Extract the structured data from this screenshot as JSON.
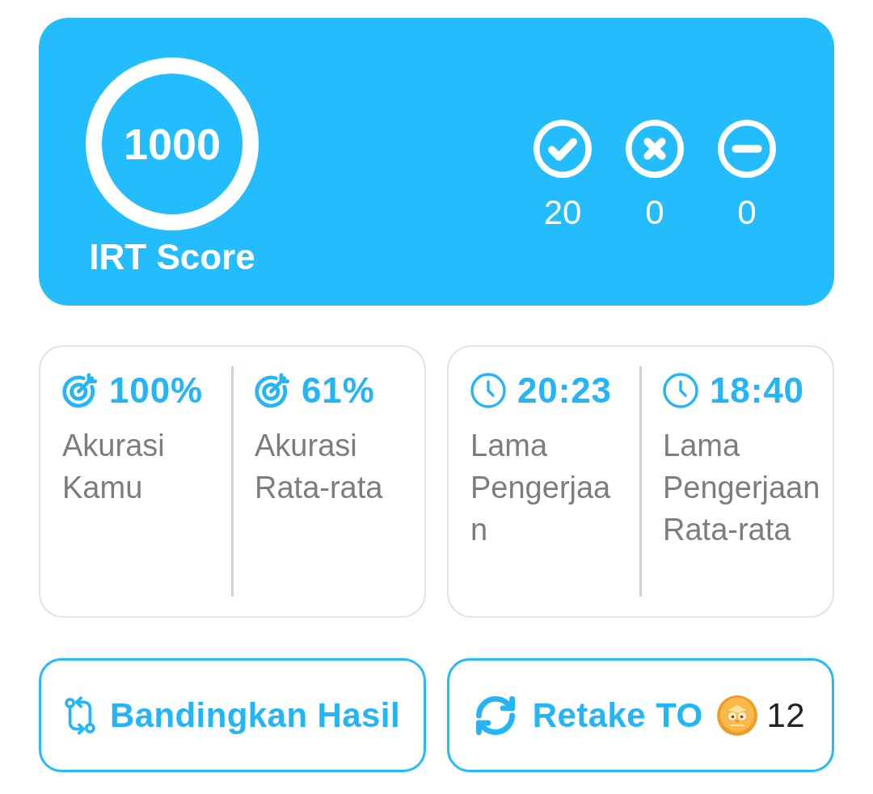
{
  "score_card": {
    "score": "1000",
    "label": "IRT Score"
  },
  "answer_counts": [
    {
      "kind": "correct",
      "count": "20"
    },
    {
      "kind": "wrong",
      "count": "0"
    },
    {
      "kind": "skipped",
      "count": "0"
    }
  ],
  "stat_cards": [
    {
      "stats": [
        {
          "kind": "accuracy",
          "value": "100%",
          "label": "Akurasi Kamu"
        },
        {
          "kind": "accuracy",
          "value": "61%",
          "label": "Akurasi Rata-rata"
        }
      ]
    },
    {
      "stats": [
        {
          "kind": "time",
          "value": "20:23",
          "label": "Lama Pengerjaan"
        },
        {
          "kind": "time",
          "value": "18:40",
          "label": "Lama Pengerjaan Rata-rata"
        }
      ]
    }
  ],
  "buttons": [
    {
      "kind": "compare",
      "label": "Bandingkan Hasil"
    },
    {
      "kind": "retake",
      "label": "Retake TO",
      "cost": "12"
    }
  ]
}
